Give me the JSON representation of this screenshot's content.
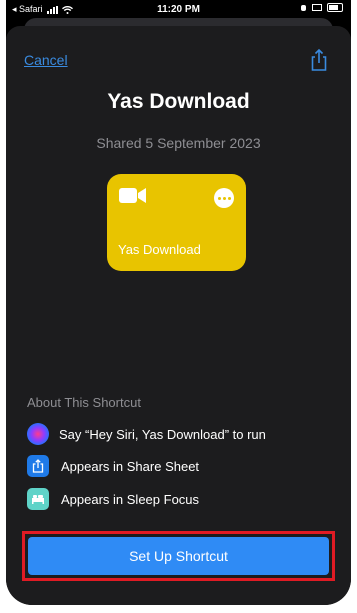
{
  "status_bar": {
    "back_app": "◂ Safari",
    "time": "11:20 PM"
  },
  "sheet": {
    "cancel_label": "Cancel",
    "title": "Yas Download",
    "shared_date": "Shared 5 September 2023"
  },
  "tile": {
    "label": "Yas Download",
    "color": "#e8c400",
    "icon": "video-camera-icon"
  },
  "about": {
    "heading": "About This Shortcut",
    "items": [
      {
        "icon": "siri-icon",
        "text": "Say “Hey Siri, Yas Download” to run"
      },
      {
        "icon": "share-sheet-icon",
        "text": "Appears in Share Sheet"
      },
      {
        "icon": "sleep-bed-icon",
        "text": "Appears in Sleep Focus"
      }
    ]
  },
  "primary_button": {
    "label": "Set Up Shortcut",
    "color": "#2f8bf5"
  },
  "highlight_color": "#e01b24"
}
